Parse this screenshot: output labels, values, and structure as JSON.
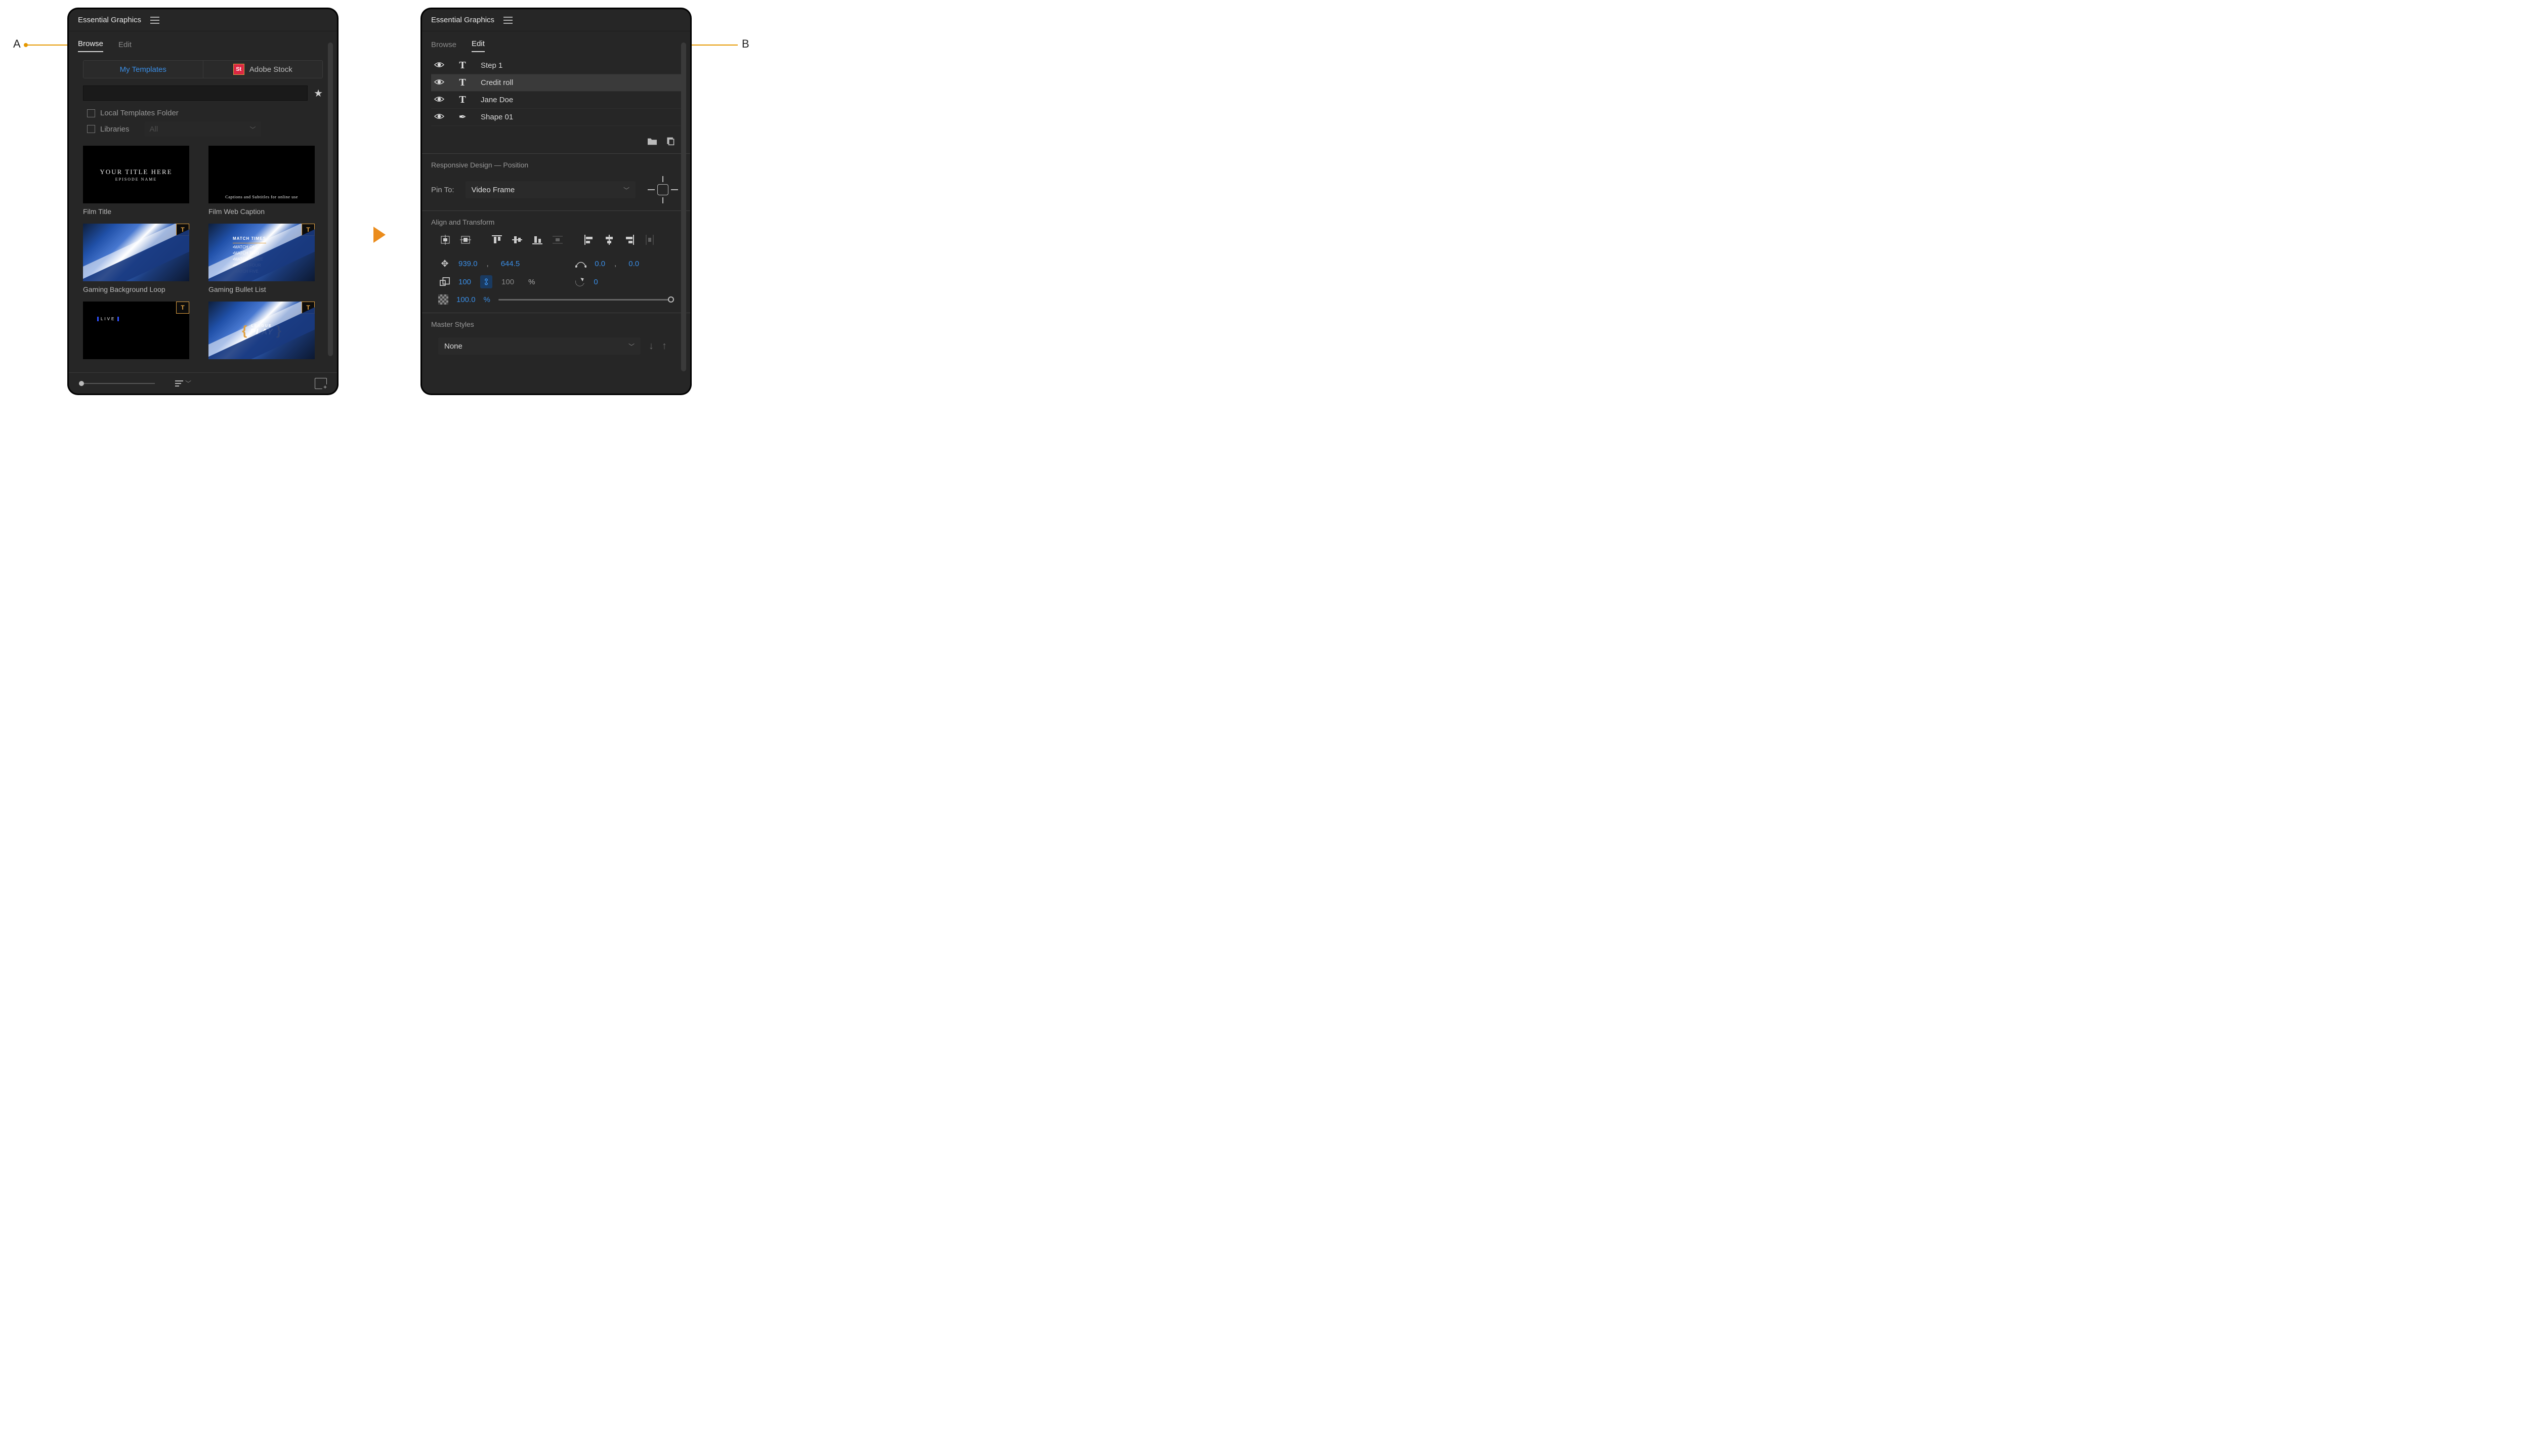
{
  "callouts": {
    "a": "A",
    "b": "B"
  },
  "leftPanel": {
    "title": "Essential Graphics",
    "tabs": {
      "browse": "Browse",
      "edit": "Edit"
    },
    "segments": {
      "my": "My Templates",
      "stock": "Adobe Stock",
      "stockBadge": "St"
    },
    "search": {
      "value": "",
      "placeholder": ""
    },
    "filters": {
      "local": "Local Templates Folder",
      "libraries": "Libraries",
      "librariesDropdown": "All"
    },
    "thumbs": [
      {
        "label": "Film Title",
        "line1": "YOUR TITLE HERE",
        "line2": "EPISODE NAME"
      },
      {
        "label": "Film Web Caption",
        "line1": "Captions and Subtitles for online use"
      },
      {
        "label": "Gaming Background Loop"
      },
      {
        "label": "Gaming Bullet List",
        "header": "MATCH TIMES",
        "bullets": [
          "MATCH ONE",
          "MATCH TWO",
          "MATCH THREE",
          "MATCH FOUR",
          "MATCH FIVE"
        ]
      },
      {
        "label": "",
        "live": "LIVE"
      },
      {
        "label": "",
        "small": "LEAGUE",
        "big": "PLAY"
      }
    ]
  },
  "rightPanel": {
    "title": "Essential Graphics",
    "tabs": {
      "browse": "Browse",
      "edit": "Edit"
    },
    "layers": [
      {
        "name": "Step 1",
        "type": "text",
        "selected": false
      },
      {
        "name": "Credit roll",
        "type": "text",
        "selected": true
      },
      {
        "name": "Jane Doe",
        "type": "text",
        "selected": false
      },
      {
        "name": "Shape 01",
        "type": "shape",
        "selected": false
      }
    ],
    "responsive": {
      "title": "Responsive Design — Position",
      "pinToLabel": "Pin To:",
      "pinToValue": "Video Frame"
    },
    "align": {
      "title": "Align and Transform"
    },
    "position": {
      "x": "939.0",
      "y": "644.5"
    },
    "anchor": {
      "x": "0.0",
      "y": "0.0"
    },
    "scale": {
      "w": "100",
      "h": "100",
      "unit": "%"
    },
    "rotation": "0",
    "opacity": {
      "value": "100.0",
      "unit": "%"
    },
    "master": {
      "title": "Master Styles",
      "value": "None"
    }
  }
}
